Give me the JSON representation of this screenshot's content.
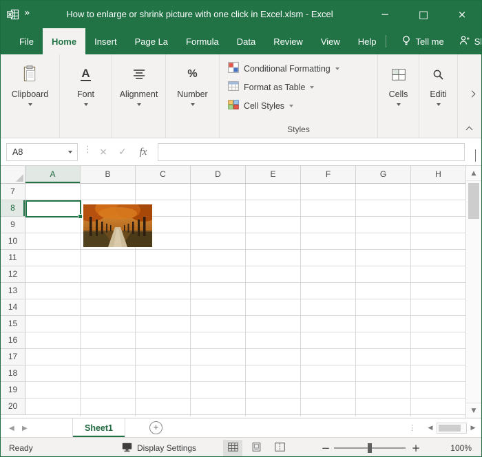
{
  "colors": {
    "excel_green": "#217346",
    "ribbon_bg": "#f3f2f1",
    "grid_line": "#dadada"
  },
  "title_bar": {
    "overflow_chevron": "»",
    "title": "How to enlarge or shrink picture with one click in Excel.xlsm  -  Excel",
    "minimize": "─",
    "maximize": "□",
    "close": "×"
  },
  "menu": {
    "tabs": [
      {
        "label": "File"
      },
      {
        "label": "Home"
      },
      {
        "label": "Insert"
      },
      {
        "label": "Page La"
      },
      {
        "label": "Formula"
      },
      {
        "label": "Data"
      },
      {
        "label": "Review"
      },
      {
        "label": "View"
      },
      {
        "label": "Help"
      }
    ],
    "active_tab": "Home",
    "tell_me": "Tell me",
    "share": "Share"
  },
  "ribbon": {
    "groups": [
      {
        "label": "Clipboard"
      },
      {
        "label": "Font"
      },
      {
        "label": "Alignment"
      },
      {
        "label": "Number"
      }
    ],
    "styles": {
      "items": [
        {
          "label": "Conditional Formatting"
        },
        {
          "label": "Format as Table"
        },
        {
          "label": "Cell Styles"
        }
      ],
      "caption": "Styles"
    },
    "right_groups": [
      {
        "label": "Cells"
      },
      {
        "label": "Editi"
      }
    ]
  },
  "formula_bar": {
    "name_box": "A8",
    "cancel": "×",
    "enter": "✓",
    "fx": "fx",
    "formula_value": ""
  },
  "grid": {
    "columns": [
      "A",
      "B",
      "C",
      "D",
      "E",
      "F",
      "G",
      "H"
    ],
    "rows": [
      "7",
      "8",
      "9",
      "10",
      "11",
      "12",
      "13",
      "14",
      "15",
      "16",
      "17",
      "18",
      "19",
      "20"
    ],
    "selected_cell": "A8",
    "picture_cell": "B8"
  },
  "sheet_tabs": {
    "tabs": [
      {
        "label": "Sheet1"
      }
    ],
    "add_sheet": "+"
  },
  "status_bar": {
    "ready": "Ready",
    "display_settings": "Display Settings",
    "zoom_out": "−",
    "zoom_in": "+",
    "zoom_level": "100%"
  }
}
